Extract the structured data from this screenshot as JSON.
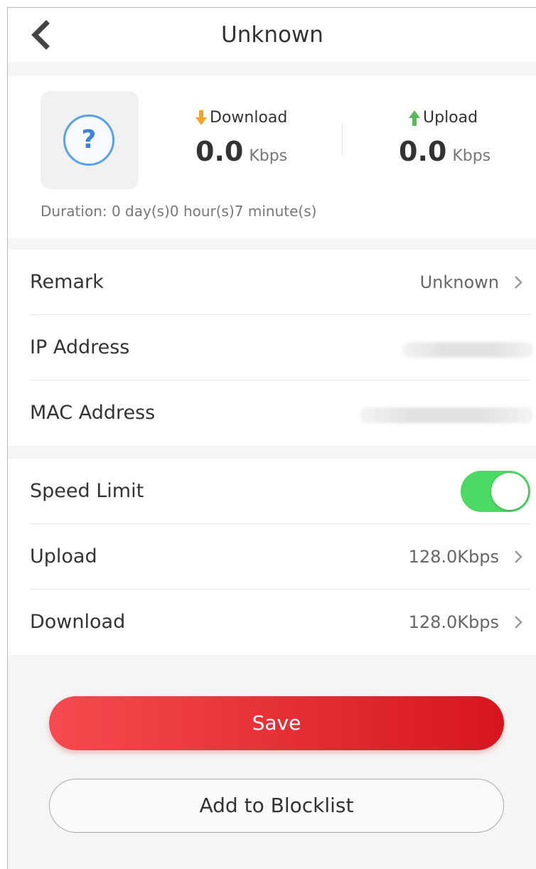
{
  "header": {
    "title": "Unknown"
  },
  "stats": {
    "download_label": "Download",
    "download_value": "0.0",
    "download_unit": "Kbps",
    "upload_label": "Upload",
    "upload_value": "0.0",
    "upload_unit": "Kbps",
    "duration": "Duration: 0 day(s)0 hour(s)7 minute(s)",
    "device_icon": "question-mark-icon"
  },
  "info": {
    "remark_label": "Remark",
    "remark_value": "Unknown",
    "ip_label": "IP Address",
    "mac_label": "MAC Address"
  },
  "limits": {
    "speed_limit_label": "Speed Limit",
    "speed_limit_on": true,
    "upload_label": "Upload",
    "upload_value": "128.0Kbps",
    "download_label": "Download",
    "download_value": "128.0Kbps"
  },
  "actions": {
    "save_label": "Save",
    "blocklist_label": "Add to Blocklist"
  },
  "colors": {
    "accent_red": "#e0242b",
    "toggle_green": "#4cd964",
    "download_arrow": "#f5a623",
    "upload_arrow": "#5cb85c",
    "device_icon": "#3d82d6"
  }
}
